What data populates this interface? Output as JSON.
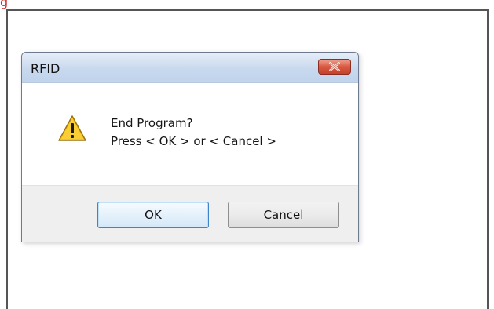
{
  "page": {
    "top_fragment_text": "g"
  },
  "dialog": {
    "title": "RFID",
    "message_line1": "End Program?",
    "message_line2": "Press < OK > or < Cancel >",
    "ok_label": "OK",
    "cancel_label": "Cancel",
    "icons": {
      "warning": "warning-icon",
      "close": "close-icon"
    },
    "colors": {
      "title_bar": "#c8d9ee",
      "close_button": "#d95a43",
      "ok_border": "#3f84c6",
      "footer": "#efefef"
    }
  }
}
